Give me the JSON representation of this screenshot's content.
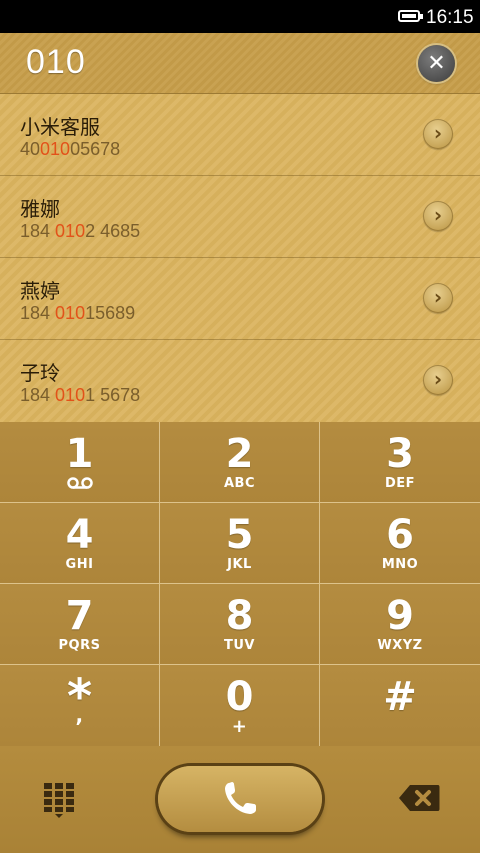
{
  "status_bar": {
    "time": "16:15"
  },
  "dial": {
    "number": "010"
  },
  "contacts": [
    {
      "name": "小米客服",
      "num_pre": "40",
      "num_hl": "010",
      "num_post": "05678"
    },
    {
      "name": "雅娜",
      "num_pre": "184 ",
      "num_hl": "010",
      "num_post": "2 4685"
    },
    {
      "name": "燕婷",
      "num_pre": "184 ",
      "num_hl": "010",
      "num_post": "15689"
    },
    {
      "name": "子玲",
      "num_pre": "184 ",
      "num_hl": "010",
      "num_post": "1 5678"
    }
  ],
  "keypad": [
    {
      "digit": "1",
      "letters": ""
    },
    {
      "digit": "2",
      "letters": "ABC"
    },
    {
      "digit": "3",
      "letters": "DEF"
    },
    {
      "digit": "4",
      "letters": "GHI"
    },
    {
      "digit": "5",
      "letters": "JKL"
    },
    {
      "digit": "6",
      "letters": "MNO"
    },
    {
      "digit": "7",
      "letters": "PQRS"
    },
    {
      "digit": "8",
      "letters": "TUV"
    },
    {
      "digit": "9",
      "letters": "WXYZ"
    },
    {
      "digit": "*",
      "letters": ","
    },
    {
      "digit": "0",
      "letters": "+"
    },
    {
      "digit": "#",
      "letters": ""
    }
  ],
  "icons": {
    "clear": "close-icon",
    "contact_arrow": "chevron-right-icon",
    "voicemail": "voicemail-icon",
    "keypad_toggle": "keypad-grid-icon",
    "call": "phone-icon",
    "delete": "backspace-icon"
  },
  "colors": {
    "highlight": "#e2521a",
    "text_dark": "#2a1d08",
    "status_bg": "#000000"
  }
}
